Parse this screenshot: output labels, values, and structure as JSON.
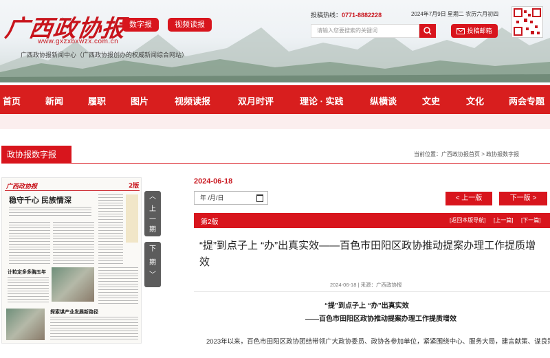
{
  "header": {
    "logo_text": "广西政协报",
    "site_url": "www.gxzxbxwzx.com.cn",
    "site_desc": "广西政协报新闻中心（广西政协报创办的权威新闻综合网站）",
    "buttons": [
      "数字报",
      "视频读报"
    ],
    "hotline_label": "投稿热线：",
    "hotline_number": "0771-8882228",
    "date_text": "2024年7月9日 星期二 农历六月初四",
    "search_placeholder": "请输入您要搜索的关键词",
    "submit_label": "投稿邮箱"
  },
  "nav": {
    "items": [
      "首页",
      "新闻",
      "履职",
      "图片",
      "视频读报",
      "双月时评",
      "理论 · 实践",
      "纵横谈",
      "文史",
      "文化",
      "两会专题"
    ]
  },
  "section": {
    "title": "政协报数字报",
    "breadcrumb": "当前位置：广西政协报首页 > 政协报数字报"
  },
  "paper": {
    "masthead": "广西政协报",
    "page_no": "2版",
    "headline": "稳守千心 民族情深",
    "story2": "计粒定多多胸五年",
    "story3": "探索谋产业发展新路径"
  },
  "side_nav": {
    "prev_chars": [
      "上",
      "一",
      "期"
    ],
    "next_chars": [
      "下",
      "期"
    ]
  },
  "issue": {
    "date": "2024-06-18",
    "date_input_value": "年 /月/日",
    "prev_page": "< 上一版",
    "next_page": "下一版 >"
  },
  "edition_bar": {
    "edition": "第2版",
    "links": [
      "[返回本版导航]",
      "[上一篇]",
      "[下一篇]"
    ]
  },
  "article": {
    "title": "“提”到点子上 “办”出真实效——百色市田阳区政协推动提案办理工作提质增效",
    "meta": "2024-06-18 | 来源：广西政协报",
    "sub_title_1": "“提”到点子上 “办”出真实效",
    "sub_title_2": "——百色市田阳区政协推动提案办理工作提质增效",
    "body": "2023年以来，百色市田阳区政协团结带领广大政协委员、政协各参加单位，紧紧围绕中心、服务大局，建言献策、谋良策、献"
  },
  "colors": {
    "brand_red": "#d8151d",
    "nav_red": "#d81e1e"
  }
}
